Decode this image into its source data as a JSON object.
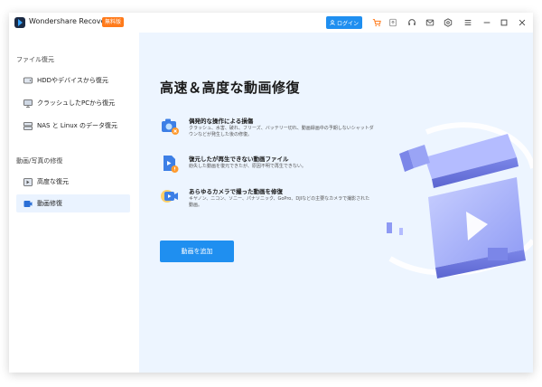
{
  "app": {
    "title": "Wondershare Recoverit",
    "badge": "無料版"
  },
  "titlebar": {
    "login_label": "ログイン"
  },
  "sidebar": {
    "file_recovery_label": "ファイル復元",
    "media_repair_label": "動画/写真の修復",
    "items": [
      {
        "label": "HDDやデバイスから復元",
        "icon": "hdd-icon"
      },
      {
        "label": "クラッシュしたPCから復元",
        "icon": "pc-icon"
      },
      {
        "label": "NAS と Linux のデータ復元",
        "icon": "nas-icon"
      },
      {
        "label": "高度な復元",
        "icon": "advanced-recovery-icon"
      },
      {
        "label": "動画修復",
        "icon": "video-repair-icon",
        "active": true
      }
    ]
  },
  "main": {
    "heading": "高速＆高度な動画修復",
    "features": [
      {
        "title": "偶発的な操作による損傷",
        "desc": "クラッシュ、水害、破れ、フリーズ、バッテリー切れ、動画録画中の予期しないシャットダウンなどが発生した後の修復。"
      },
      {
        "title": "復元したが再生できない動画ファイル",
        "desc": "紛失した動画を復元できたが、原因不明で再生できない。"
      },
      {
        "title": "あらゆるカメラで撮った動画を修復",
        "desc": "キヤノン、ニコン、ソニー、パナソニック、GoPro、DJIなどの主要なカメラで撮影された動画。"
      }
    ],
    "add_button_label": "動画を追加"
  },
  "colors": {
    "accent": "#1f8ff0",
    "badge": "#ff7a1a",
    "main_bg": "#edf5ff",
    "active_bg": "#eaf3ff"
  }
}
